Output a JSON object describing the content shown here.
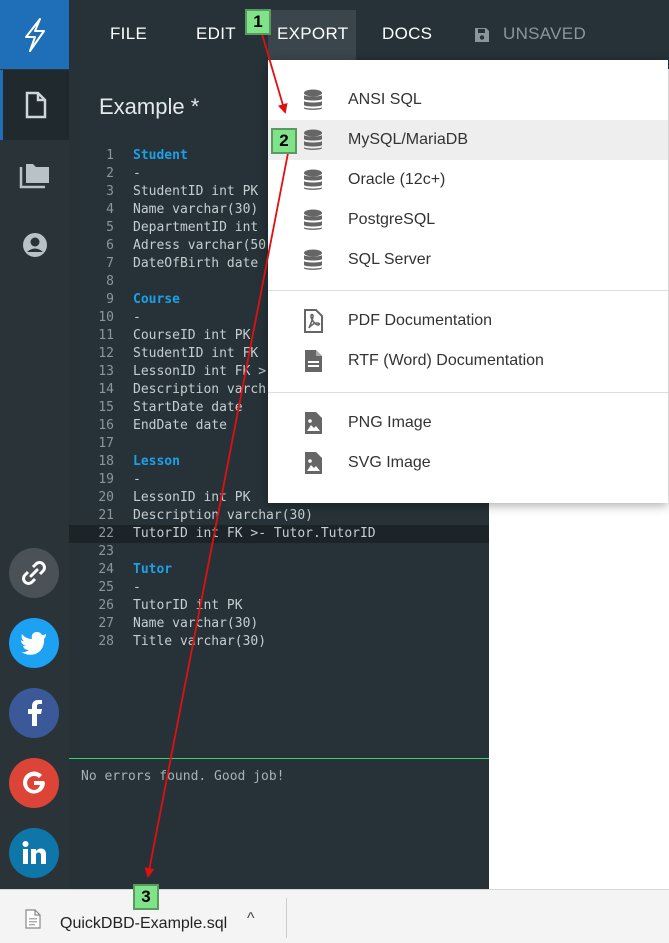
{
  "menu": {
    "file": "FILE",
    "edit": "EDIT",
    "export": "EXPORT",
    "docs": "DOCS",
    "unsaved": "UNSAVED"
  },
  "editor": {
    "title": "Example *",
    "lines": [
      {
        "n": "1",
        "t": "Student"
      },
      {
        "n": "2",
        "t": "-"
      },
      {
        "n": "3",
        "t": "StudentID int PK"
      },
      {
        "n": "4",
        "t": "Name varchar(30)"
      },
      {
        "n": "5",
        "t": "DepartmentID int"
      },
      {
        "n": "6",
        "t": "Adress varchar(50"
      },
      {
        "n": "7",
        "t": "DateOfBirth date"
      },
      {
        "n": "8",
        "t": ""
      },
      {
        "n": "9",
        "t": "Course"
      },
      {
        "n": "10",
        "t": "-"
      },
      {
        "n": "11",
        "t": "CourseID int PK"
      },
      {
        "n": "12",
        "t": "StudentID int FK"
      },
      {
        "n": "13",
        "t": "LessonID int FK >"
      },
      {
        "n": "14",
        "t": "Description varch"
      },
      {
        "n": "15",
        "t": "StartDate date"
      },
      {
        "n": "16",
        "t": "EndDate date"
      },
      {
        "n": "17",
        "t": ""
      },
      {
        "n": "18",
        "t": "Lesson"
      },
      {
        "n": "19",
        "t": "-"
      },
      {
        "n": "20",
        "t": "LessonID int PK"
      },
      {
        "n": "21",
        "t": "Description varchar(30)"
      },
      {
        "n": "22",
        "t": "TutorID int FK >- Tutor.TutorID"
      },
      {
        "n": "23",
        "t": ""
      },
      {
        "n": "24",
        "t": "Tutor"
      },
      {
        "n": "25",
        "t": "-"
      },
      {
        "n": "26",
        "t": "TutorID int PK"
      },
      {
        "n": "27",
        "t": "Name varchar(30)"
      },
      {
        "n": "28",
        "t": "Title varchar(30)"
      }
    ],
    "status": "No errors found. Good job!"
  },
  "export_menu": {
    "items": [
      {
        "label": "ANSI SQL",
        "icon": "database-icon"
      },
      {
        "label": "MySQL/MariaDB",
        "icon": "database-icon"
      },
      {
        "label": "Oracle (12c+)",
        "icon": "database-icon"
      },
      {
        "label": "PostgreSQL",
        "icon": "database-icon"
      },
      {
        "label": "SQL Server",
        "icon": "database-icon"
      },
      {
        "label": "PDF Documentation",
        "icon": "pdf-icon"
      },
      {
        "label": "RTF (Word) Documentation",
        "icon": "document-icon"
      },
      {
        "label": "PNG Image",
        "icon": "image-icon"
      },
      {
        "label": "SVG Image",
        "icon": "image-icon"
      }
    ]
  },
  "download": {
    "filename": "QuickDBD-Example.sql",
    "chevron": "^"
  },
  "badges": {
    "one": "1",
    "two": "2",
    "three": "3"
  },
  "colors": {
    "accent": "#1e6fb8",
    "table_name": "#1ea0e6",
    "annotation": "#e01010",
    "badge": "#7fe38a"
  }
}
